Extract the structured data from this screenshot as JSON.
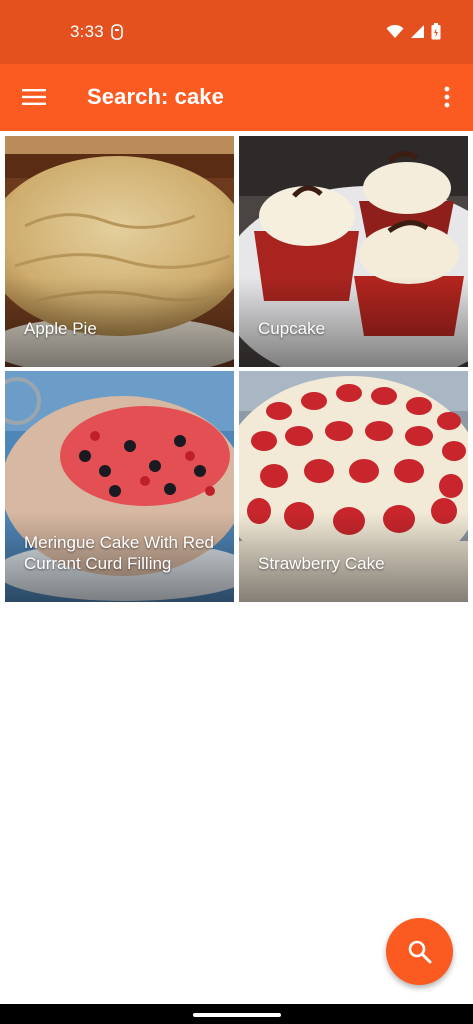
{
  "status_bar": {
    "time": "3:33",
    "icons": [
      "notification-icon",
      "wifi-icon",
      "signal-icon",
      "battery-icon"
    ]
  },
  "app_bar": {
    "title": "Search: cake",
    "menu_icon": "menu-icon",
    "overflow_icon": "more-vert-icon"
  },
  "results": [
    {
      "title": "Apple Pie"
    },
    {
      "title": "Cupcake"
    },
    {
      "title": "Meringue Cake With Red Currant Curd Filling"
    },
    {
      "title": "Strawberry Cake"
    }
  ],
  "fab": {
    "icon": "search-icon"
  },
  "colors": {
    "status_bar": "#e5501f",
    "app_bar": "#fb5a21",
    "accent": "#fb5a21"
  }
}
